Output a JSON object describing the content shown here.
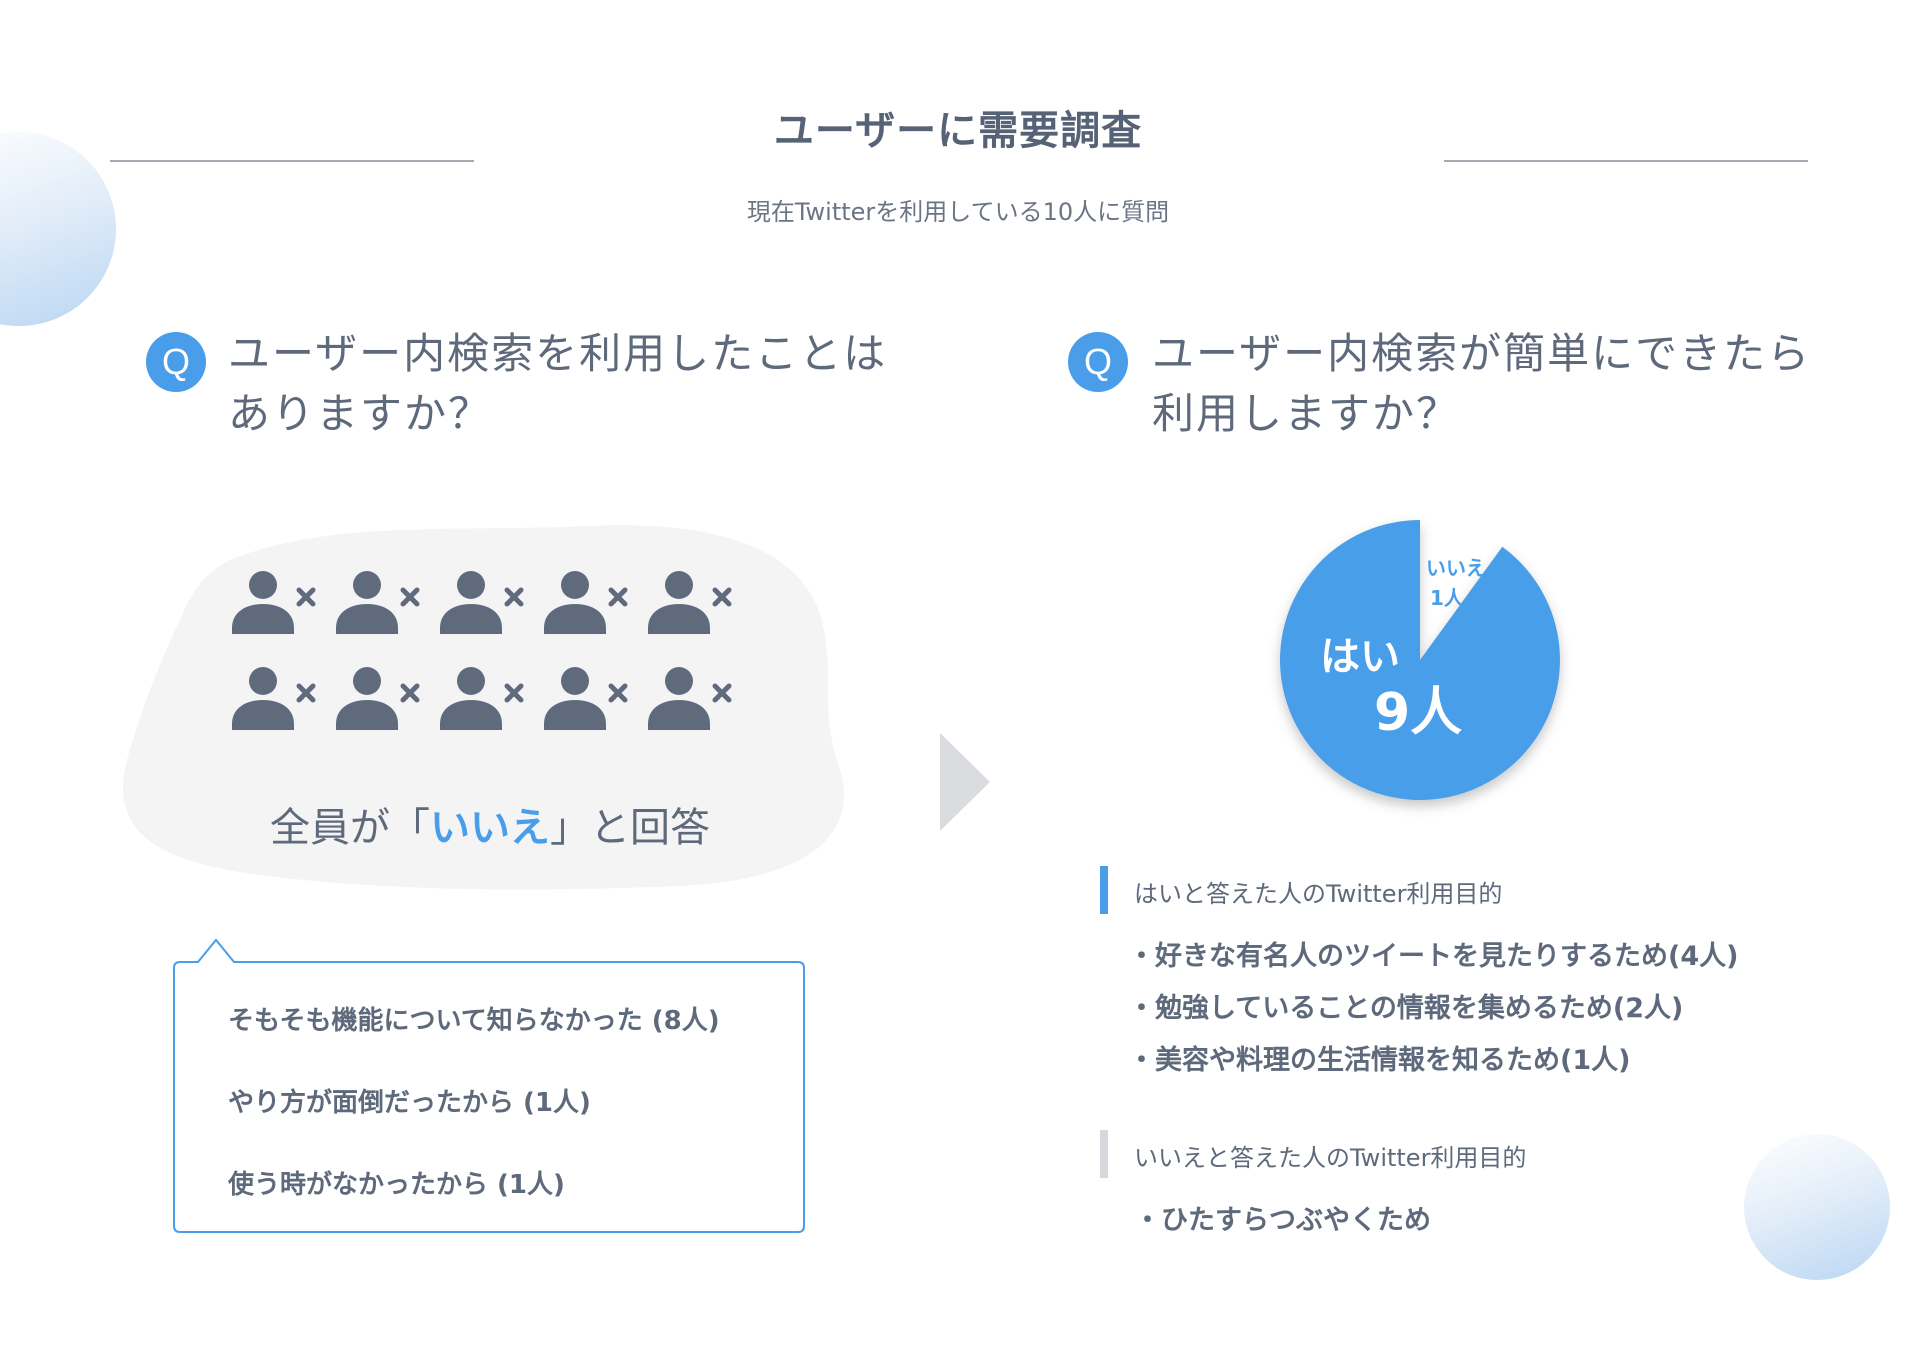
{
  "header": {
    "title": "ユーザーに需要調査",
    "subtitle": "現在Twitterを利用している10人に質問"
  },
  "q_badge": "Q",
  "question1": {
    "line1": "ユーザー内検索を利用したことは",
    "line2": "ありますか？",
    "respondents": 10,
    "caption_prefix": "全員が「",
    "caption_highlight": "いいえ",
    "caption_suffix": "」と回答",
    "reasons": [
      "そもそも機能について知らなかった (8人)",
      "やり方が面倒だったから (1人)",
      "使う時がなかったから (1人)"
    ]
  },
  "question2": {
    "line1": "ユーザー内検索が簡単にできたら",
    "line2": "利用しますか？",
    "pie": {
      "yes_label": "はい",
      "yes_count": "9人",
      "yes_value": 9,
      "no_label": "いいえ",
      "no_count": "1人",
      "no_value": 1
    },
    "yes_section": {
      "title": "はいと答えた人のTwitter利用目的",
      "items": [
        "・好きな有名人のツイートを見たりするため(4人)",
        "・勉強していることの情報を集めるため(2人)",
        "・美容や料理の生活情報を知るため(1人)"
      ]
    },
    "no_section": {
      "title": "いいえと答えた人のTwitter利用目的",
      "items": [
        "・ひたすらつぶやくため"
      ]
    }
  },
  "colors": {
    "accent": "#4a9ee9",
    "text": "#5e6a7b",
    "icon": "#5f6b7c",
    "blob": "#f4f4f5",
    "muted_bar": "#d5d9de"
  }
}
